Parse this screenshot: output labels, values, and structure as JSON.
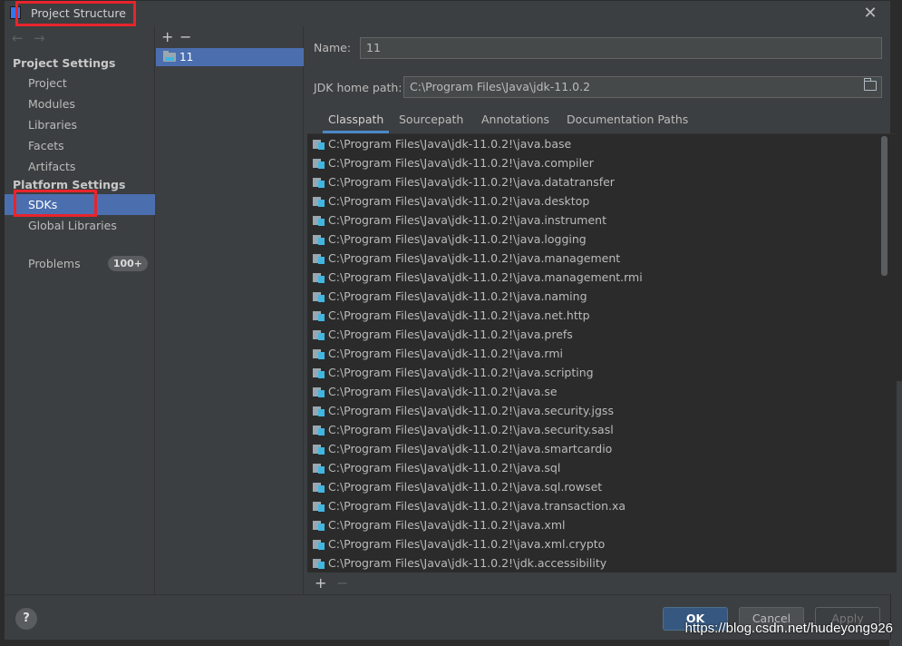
{
  "window": {
    "title": "Project Structure",
    "close_symbol": "✕"
  },
  "nav": {
    "back_symbol": "←",
    "forward_symbol": "→",
    "project_settings_heading": "Project Settings",
    "project_items": [
      "Project",
      "Modules",
      "Libraries",
      "Facets",
      "Artifacts"
    ],
    "platform_settings_heading": "Platform Settings",
    "platform_items": [
      "SDKs",
      "Global Libraries"
    ],
    "selected": "SDKs",
    "problems_label": "Problems",
    "problems_count": "100+"
  },
  "sdk_list": {
    "add_symbol": "+",
    "remove_symbol": "−",
    "items": [
      "11"
    ]
  },
  "detail": {
    "name_label": "Name:",
    "name_value": "11",
    "jdk_home_label": "JDK home path:",
    "jdk_home_value": "C:\\Program Files\\Java\\jdk-11.0.2",
    "tabs": [
      "Classpath",
      "Sourcepath",
      "Annotations",
      "Documentation Paths"
    ],
    "active_tab": "Classpath",
    "classpath": [
      "C:\\Program Files\\Java\\jdk-11.0.2!\\java.base",
      "C:\\Program Files\\Java\\jdk-11.0.2!\\java.compiler",
      "C:\\Program Files\\Java\\jdk-11.0.2!\\java.datatransfer",
      "C:\\Program Files\\Java\\jdk-11.0.2!\\java.desktop",
      "C:\\Program Files\\Java\\jdk-11.0.2!\\java.instrument",
      "C:\\Program Files\\Java\\jdk-11.0.2!\\java.logging",
      "C:\\Program Files\\Java\\jdk-11.0.2!\\java.management",
      "C:\\Program Files\\Java\\jdk-11.0.2!\\java.management.rmi",
      "C:\\Program Files\\Java\\jdk-11.0.2!\\java.naming",
      "C:\\Program Files\\Java\\jdk-11.0.2!\\java.net.http",
      "C:\\Program Files\\Java\\jdk-11.0.2!\\java.prefs",
      "C:\\Program Files\\Java\\jdk-11.0.2!\\java.rmi",
      "C:\\Program Files\\Java\\jdk-11.0.2!\\java.scripting",
      "C:\\Program Files\\Java\\jdk-11.0.2!\\java.se",
      "C:\\Program Files\\Java\\jdk-11.0.2!\\java.security.jgss",
      "C:\\Program Files\\Java\\jdk-11.0.2!\\java.security.sasl",
      "C:\\Program Files\\Java\\jdk-11.0.2!\\java.smartcardio",
      "C:\\Program Files\\Java\\jdk-11.0.2!\\java.sql",
      "C:\\Program Files\\Java\\jdk-11.0.2!\\java.sql.rowset",
      "C:\\Program Files\\Java\\jdk-11.0.2!\\java.transaction.xa",
      "C:\\Program Files\\Java\\jdk-11.0.2!\\java.xml",
      "C:\\Program Files\\Java\\jdk-11.0.2!\\java.xml.crypto",
      "C:\\Program Files\\Java\\jdk-11.0.2!\\jdk.accessibility"
    ],
    "add_path_symbol": "+",
    "remove_path_symbol": "−"
  },
  "buttons": {
    "help": "?",
    "ok": "OK",
    "cancel": "Cancel",
    "apply": "Apply"
  },
  "watermark": "https://blog.csdn.net/hudeyong926",
  "colors": {
    "selection": "#4b6eaf",
    "highlight_box": "#e8242c",
    "primary_button": "#365880"
  },
  "icons": {
    "folder": "sdk-folder-icon",
    "jar": "jar-module-icon",
    "browse": "folder-browse-icon"
  }
}
